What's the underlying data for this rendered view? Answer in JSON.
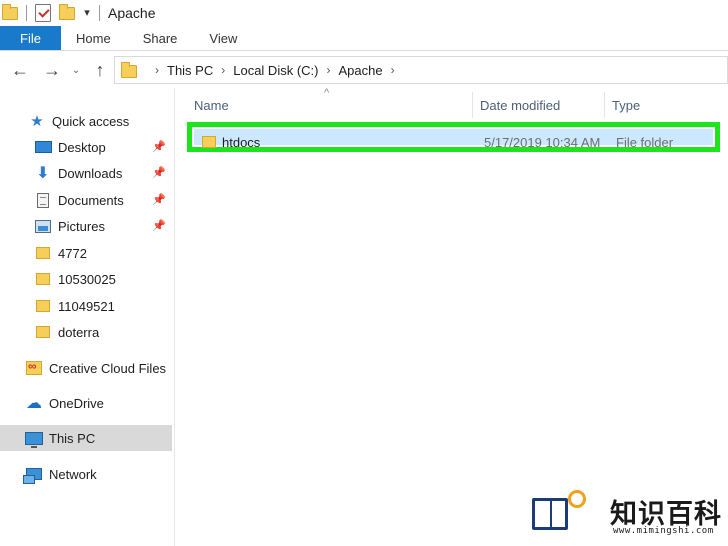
{
  "window": {
    "title": "Apache"
  },
  "quick_access_toolbar": {
    "dropdown_glyph": "▾"
  },
  "ribbon": {
    "tabs": [
      "File",
      "Home",
      "Share",
      "View"
    ]
  },
  "nav_buttons": {
    "back": "←",
    "forward": "→",
    "recent": "⌄",
    "up": "↑"
  },
  "address": {
    "crumbs": [
      "This PC",
      "Local Disk (C:)",
      "Apache"
    ],
    "separator": "›"
  },
  "nav_pane": {
    "quick_access": "Quick access",
    "pinned": [
      "Desktop",
      "Downloads",
      "Documents",
      "Pictures"
    ],
    "folders": [
      "4772",
      "10530025",
      "11049521",
      "doterra"
    ],
    "creative_cloud": "Creative Cloud Files",
    "onedrive": "OneDrive",
    "this_pc": "This PC",
    "network": "Network"
  },
  "columns": {
    "name": "Name",
    "date_modified": "Date modified",
    "type": "Type",
    "sort_indicator": "^"
  },
  "files": [
    {
      "name": "htdocs",
      "date_modified": "5/17/2019 10:34 AM",
      "type": "File folder"
    }
  ],
  "watermark": {
    "title": "知识百科",
    "url": "www.mimingshi.com"
  },
  "colors": {
    "file_tab": "#1979ca",
    "selection": "#cce8ff",
    "highlight_outline": "#1de51d",
    "nav_selected": "#d9d9d9"
  },
  "icons": {
    "pin": "pin-icon",
    "quick_access": "star-icon",
    "desktop": "desktop-icon",
    "downloads": "download-arrow-icon",
    "documents": "document-icon",
    "pictures": "pictures-icon",
    "folder": "folder-icon",
    "onedrive": "cloud-icon",
    "this_pc": "computer-icon",
    "network": "network-icon"
  }
}
